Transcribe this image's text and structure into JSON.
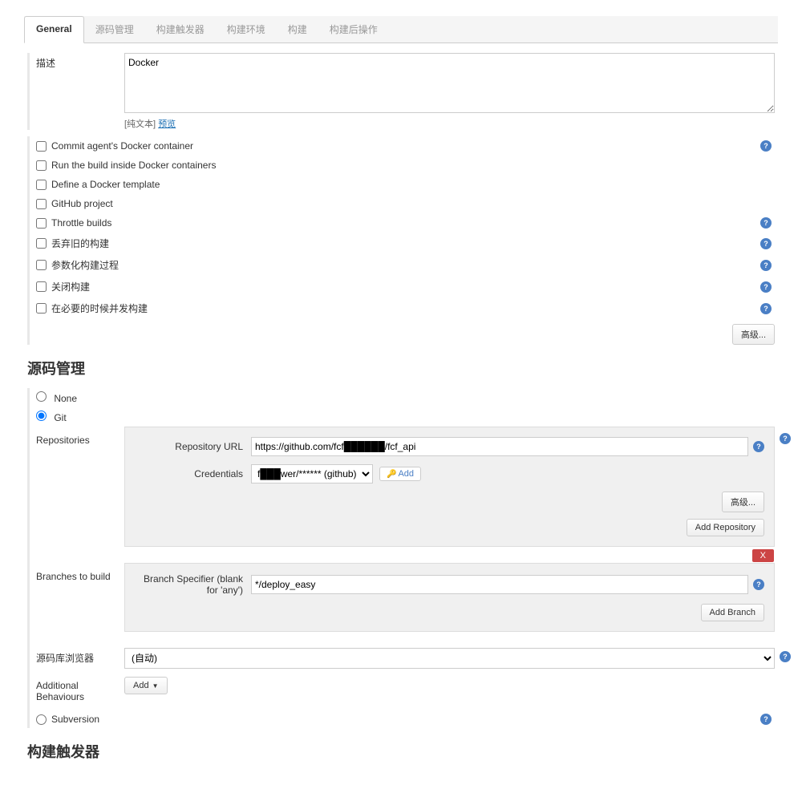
{
  "tabs": {
    "general": "General",
    "scm": "源码管理",
    "triggers": "构建触发器",
    "environment": "构建环境",
    "build": "构建",
    "postbuild": "构建后操作"
  },
  "general": {
    "description_label": "描述",
    "description_value": "Docker",
    "plain_text": "[纯文本]",
    "preview": "预览",
    "checkboxes": {
      "commit_agent": "Commit agent's Docker container",
      "run_inside": "Run the build inside Docker containers",
      "define_template": "Define a Docker template",
      "github_project": "GitHub project",
      "throttle": "Throttle builds",
      "discard_old": "丢弃旧的构建",
      "parameterized": "参数化构建过程",
      "disable": "关闭构建",
      "concurrent": "在必要的时候并发构建"
    },
    "advanced_btn": "高级..."
  },
  "scm": {
    "title": "源码管理",
    "none": "None",
    "git": "Git",
    "subversion": "Subversion",
    "repositories_label": "Repositories",
    "repo_url_label": "Repository URL",
    "repo_url_value": "https://github.com/fcf██████/fcf_api",
    "credentials_label": "Credentials",
    "credentials_value": "f███wer/****** (github)",
    "add_cred_btn": "Add",
    "repo_advanced_btn": "高级...",
    "add_repo_btn": "Add Repository",
    "branches_label": "Branches to build",
    "branch_spec_label": "Branch Specifier (blank for 'any')",
    "branch_spec_value": "*/deploy_easy",
    "delete_btn": "X",
    "add_branch_btn": "Add Branch",
    "repo_browser_label": "源码库浏览器",
    "repo_browser_value": "(自动)",
    "additional_label": "Additional Behaviours",
    "add_behaviour_btn": "Add"
  },
  "triggers": {
    "title": "构建触发器"
  }
}
